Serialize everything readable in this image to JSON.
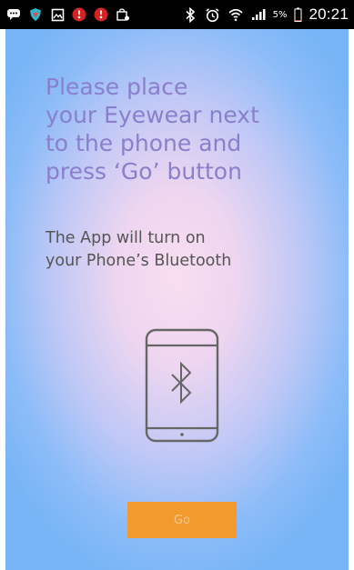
{
  "status_bar": {
    "left_icons": [
      "chat-icon",
      "shield-icon",
      "image-icon",
      "yelp-icon",
      "yelp-icon",
      "shopping-bag-icon"
    ],
    "right_icons": [
      "bluetooth-icon",
      "alarm-icon",
      "wifi-icon",
      "signal-icon",
      "battery-icon"
    ],
    "battery_percent": "5%",
    "time": "20:21"
  },
  "main": {
    "instruction": "Please place\nyour Eyewear next\nto the phone and\npress ‘Go’ button",
    "subtext": "The App will turn on\nyour Phone’s Bluetooth",
    "graphic_icon": "phone-bluetooth-icon",
    "go_label": "Go"
  },
  "colors": {
    "instruction_text": "#8a7fcc",
    "subtext": "#555555",
    "button": "#f39a2e",
    "button_text": "#f8c890",
    "background_center": "#f8deef",
    "background_edge": "#78b5f6"
  }
}
